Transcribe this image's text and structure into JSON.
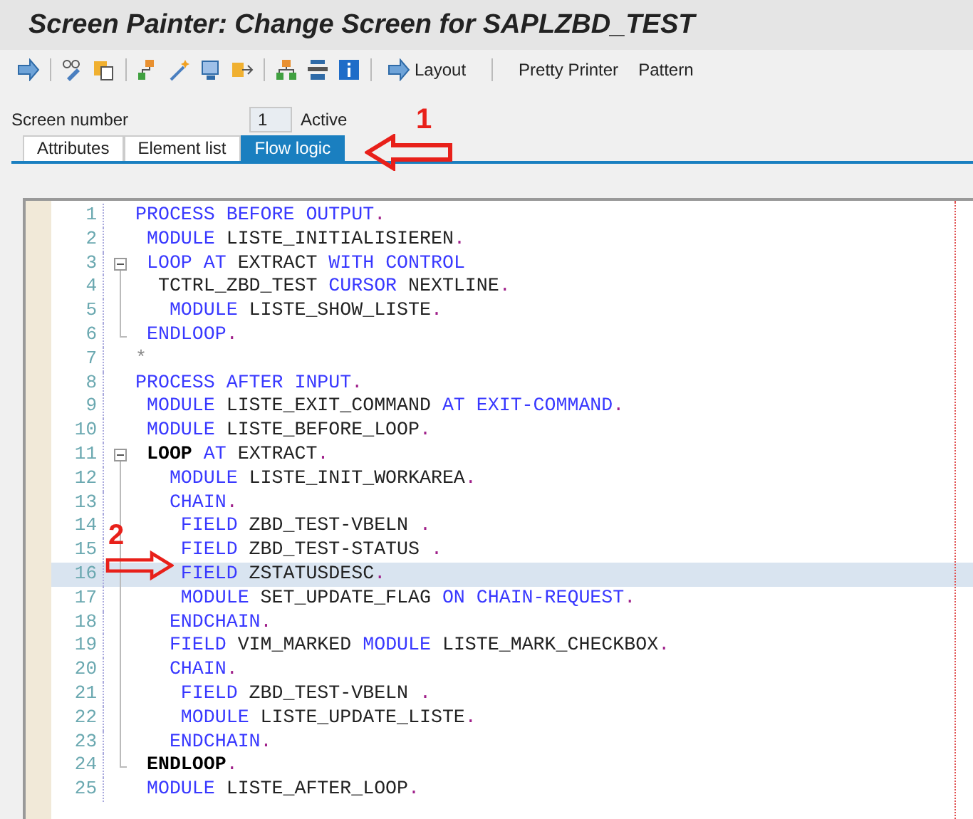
{
  "window": {
    "title": "Screen Painter: Change Screen for SAPLZBD_TEST"
  },
  "toolbar": {
    "buttons": [
      {
        "label": "Layout",
        "kind": "icon-text"
      },
      {
        "label": "Pretty Printer",
        "kind": "text"
      },
      {
        "label": "Pattern",
        "kind": "text"
      }
    ]
  },
  "screen_number": {
    "label": "Screen number",
    "value": "1",
    "status": "Active"
  },
  "tabs": [
    {
      "label": "Attributes",
      "selected": false
    },
    {
      "label": "Element list",
      "selected": false
    },
    {
      "label": "Flow logic",
      "selected": true
    }
  ],
  "editor": {
    "lines": [
      {
        "number": "1",
        "collapsible": false,
        "in_block": false,
        "selected": false,
        "tokens": [
          {
            "text": "PROCESS BEFORE OUTPUT",
            "kind": "kw"
          },
          {
            "text": ".",
            "kind": "op"
          }
        ]
      },
      {
        "number": "2",
        "collapsible": false,
        "in_block": false,
        "selected": false,
        "tokens": [
          {
            "text": " MODULE",
            "kind": "kw"
          },
          {
            "text": " LISTE_INITIALISIEREN",
            "kind": "id"
          },
          {
            "text": ".",
            "kind": "op"
          }
        ]
      },
      {
        "number": "3",
        "collapsible": true,
        "in_block": false,
        "selected": false,
        "tokens": [
          {
            "text": " LOOP AT",
            "kind": "kw"
          },
          {
            "text": " EXTRACT",
            "kind": "id"
          },
          {
            "text": " WITH CONTROL",
            "kind": "kw"
          }
        ]
      },
      {
        "number": "4",
        "collapsible": false,
        "in_block": true,
        "selected": false,
        "tokens": [
          {
            "text": "  TCTRL_ZBD_TEST",
            "kind": "id"
          },
          {
            "text": " CURSOR",
            "kind": "kw"
          },
          {
            "text": " NEXTLINE",
            "kind": "id"
          },
          {
            "text": ".",
            "kind": "op"
          }
        ]
      },
      {
        "number": "5",
        "collapsible": false,
        "in_block": true,
        "selected": false,
        "tokens": [
          {
            "text": "   MODULE",
            "kind": "kw"
          },
          {
            "text": " LISTE_SHOW_LISTE",
            "kind": "id"
          },
          {
            "text": ".",
            "kind": "op"
          }
        ]
      },
      {
        "number": "6",
        "collapsible": false,
        "in_block": true,
        "selected": false,
        "tokens": [
          {
            "text": " ENDLOOP",
            "kind": "kw"
          },
          {
            "text": ".",
            "kind": "op"
          }
        ]
      },
      {
        "number": "7",
        "collapsible": false,
        "in_block": false,
        "selected": false,
        "tokens": [
          {
            "text": "*",
            "kind": "comment"
          }
        ]
      },
      {
        "number": "8",
        "collapsible": false,
        "in_block": false,
        "selected": false,
        "tokens": [
          {
            "text": "PROCESS AFTER INPUT",
            "kind": "kw"
          },
          {
            "text": ".",
            "kind": "op"
          }
        ]
      },
      {
        "number": "9",
        "collapsible": false,
        "in_block": false,
        "selected": false,
        "tokens": [
          {
            "text": " MODULE",
            "kind": "kw"
          },
          {
            "text": " LISTE_EXIT_COMMAND",
            "kind": "id"
          },
          {
            "text": " AT EXIT-COMMAND",
            "kind": "kw"
          },
          {
            "text": ".",
            "kind": "op"
          }
        ]
      },
      {
        "number": "10",
        "collapsible": false,
        "in_block": false,
        "selected": false,
        "tokens": [
          {
            "text": " MODULE",
            "kind": "kw"
          },
          {
            "text": " LISTE_BEFORE_LOOP",
            "kind": "id"
          },
          {
            "text": ".",
            "kind": "op"
          }
        ]
      },
      {
        "number": "11",
        "collapsible": true,
        "in_block": false,
        "selected": false,
        "tokens": [
          {
            "text": " LOOP",
            "kind": "bold"
          },
          {
            "text": " AT",
            "kind": "kw"
          },
          {
            "text": " EXTRACT",
            "kind": "id"
          },
          {
            "text": ".",
            "kind": "op"
          }
        ]
      },
      {
        "number": "12",
        "collapsible": false,
        "in_block": true,
        "selected": false,
        "tokens": [
          {
            "text": "   MODULE",
            "kind": "kw"
          },
          {
            "text": " LISTE_INIT_WORKAREA",
            "kind": "id"
          },
          {
            "text": ".",
            "kind": "op"
          }
        ]
      },
      {
        "number": "13",
        "collapsible": false,
        "in_block": true,
        "selected": false,
        "tokens": [
          {
            "text": "   CHAIN",
            "kind": "kw"
          },
          {
            "text": ".",
            "kind": "op"
          }
        ]
      },
      {
        "number": "14",
        "collapsible": false,
        "in_block": true,
        "selected": false,
        "tokens": [
          {
            "text": "    FIELD",
            "kind": "kw"
          },
          {
            "text": " ZBD_TEST-VBELN ",
            "kind": "id"
          },
          {
            "text": ".",
            "kind": "op"
          }
        ]
      },
      {
        "number": "15",
        "collapsible": false,
        "in_block": true,
        "selected": false,
        "tokens": [
          {
            "text": "    FIELD",
            "kind": "kw"
          },
          {
            "text": " ZBD_TEST-STATUS ",
            "kind": "id"
          },
          {
            "text": ".",
            "kind": "op"
          }
        ]
      },
      {
        "number": "16",
        "collapsible": false,
        "in_block": true,
        "selected": true,
        "tokens": [
          {
            "text": "    FIELD",
            "kind": "kw"
          },
          {
            "text": " ZSTATUSDESC",
            "kind": "id"
          },
          {
            "text": ".",
            "kind": "op"
          }
        ]
      },
      {
        "number": "17",
        "collapsible": false,
        "in_block": true,
        "selected": false,
        "tokens": [
          {
            "text": "    MODULE",
            "kind": "kw"
          },
          {
            "text": " SET_UPDATE_FLAG",
            "kind": "id"
          },
          {
            "text": " ON CHAIN-REQUEST",
            "kind": "kw"
          },
          {
            "text": ".",
            "kind": "op"
          }
        ]
      },
      {
        "number": "18",
        "collapsible": false,
        "in_block": true,
        "selected": false,
        "tokens": [
          {
            "text": "   ENDCHAIN",
            "kind": "kw"
          },
          {
            "text": ".",
            "kind": "op"
          }
        ]
      },
      {
        "number": "19",
        "collapsible": false,
        "in_block": true,
        "selected": false,
        "tokens": [
          {
            "text": "   FIELD",
            "kind": "kw"
          },
          {
            "text": " VIM_MARKED",
            "kind": "id"
          },
          {
            "text": " MODULE",
            "kind": "kw"
          },
          {
            "text": " LISTE_MARK_CHECKBOX",
            "kind": "id"
          },
          {
            "text": ".",
            "kind": "op"
          }
        ]
      },
      {
        "number": "20",
        "collapsible": false,
        "in_block": true,
        "selected": false,
        "tokens": [
          {
            "text": "   CHAIN",
            "kind": "kw"
          },
          {
            "text": ".",
            "kind": "op"
          }
        ]
      },
      {
        "number": "21",
        "collapsible": false,
        "in_block": true,
        "selected": false,
        "tokens": [
          {
            "text": "    FIELD",
            "kind": "kw"
          },
          {
            "text": " ZBD_TEST-VBELN ",
            "kind": "id"
          },
          {
            "text": ".",
            "kind": "op"
          }
        ]
      },
      {
        "number": "22",
        "collapsible": false,
        "in_block": true,
        "selected": false,
        "tokens": [
          {
            "text": "    MODULE",
            "kind": "kw"
          },
          {
            "text": " LISTE_UPDATE_LISTE",
            "kind": "id"
          },
          {
            "text": ".",
            "kind": "op"
          }
        ]
      },
      {
        "number": "23",
        "collapsible": false,
        "in_block": true,
        "selected": false,
        "tokens": [
          {
            "text": "   ENDCHAIN",
            "kind": "kw"
          },
          {
            "text": ".",
            "kind": "op"
          }
        ]
      },
      {
        "number": "24",
        "collapsible": false,
        "in_block": true,
        "selected": false,
        "tokens": [
          {
            "text": " ENDLOOP",
            "kind": "bold"
          },
          {
            "text": ".",
            "kind": "op"
          }
        ]
      },
      {
        "number": "25",
        "collapsible": false,
        "in_block": false,
        "selected": false,
        "tokens": [
          {
            "text": " MODULE",
            "kind": "kw"
          },
          {
            "text": " LISTE_AFTER_LOOP",
            "kind": "id"
          },
          {
            "text": ".",
            "kind": "op"
          }
        ]
      }
    ]
  },
  "annotations": [
    {
      "label": "1",
      "kind": "left"
    },
    {
      "label": "2",
      "kind": "right"
    }
  ]
}
